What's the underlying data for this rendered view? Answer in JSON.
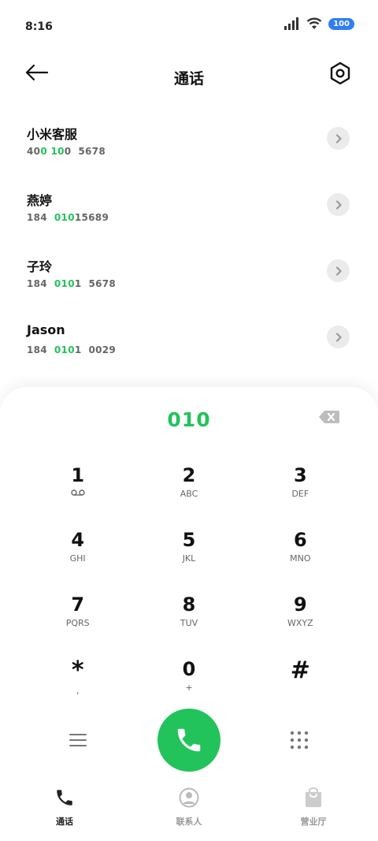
{
  "status_bar": {
    "time": "8:16",
    "battery": "100"
  },
  "header": {
    "title": "通话"
  },
  "contacts": [
    {
      "name": "小米客服",
      "number_parts": [
        {
          "text": "40",
          "highlight": false
        },
        {
          "text": "0",
          "highlight": true
        },
        {
          "text": " ",
          "highlight": false
        },
        {
          "text": "10",
          "highlight": true
        },
        {
          "text": "0  5678",
          "highlight": false
        }
      ]
    },
    {
      "name": "燕婷",
      "number_parts": [
        {
          "text": "184  ",
          "highlight": false
        },
        {
          "text": "010",
          "highlight": true
        },
        {
          "text": "15689",
          "highlight": false
        }
      ]
    },
    {
      "name": "子玲",
      "number_parts": [
        {
          "text": "184  ",
          "highlight": false
        },
        {
          "text": "010",
          "highlight": true
        },
        {
          "text": "1  5678",
          "highlight": false
        }
      ]
    },
    {
      "name": "Jason",
      "number_parts": [
        {
          "text": "184  ",
          "highlight": false
        },
        {
          "text": "010",
          "highlight": true
        },
        {
          "text": "1  0029",
          "highlight": false
        }
      ]
    }
  ],
  "dialer": {
    "display": "010",
    "keys": [
      {
        "digit": "1",
        "sub": "",
        "voicemail": true
      },
      {
        "digit": "2",
        "sub": "ABC"
      },
      {
        "digit": "3",
        "sub": "DEF"
      },
      {
        "digit": "4",
        "sub": "GHI"
      },
      {
        "digit": "5",
        "sub": "JKL"
      },
      {
        "digit": "6",
        "sub": "MNO"
      },
      {
        "digit": "7",
        "sub": "PQRS"
      },
      {
        "digit": "8",
        "sub": "TUV"
      },
      {
        "digit": "9",
        "sub": "WXYZ"
      },
      {
        "digit": "*",
        "sub": ","
      },
      {
        "digit": "0",
        "sub": "+"
      },
      {
        "digit": "#",
        "sub": ""
      }
    ]
  },
  "nav": [
    {
      "label": "通话",
      "icon": "phone-icon",
      "active": true
    },
    {
      "label": "联系人",
      "icon": "contacts-icon",
      "active": false
    },
    {
      "label": "营业厅",
      "icon": "shop-icon",
      "active": false
    }
  ],
  "colors": {
    "accent": "#22c35a",
    "battery": "#2f7cf6"
  }
}
